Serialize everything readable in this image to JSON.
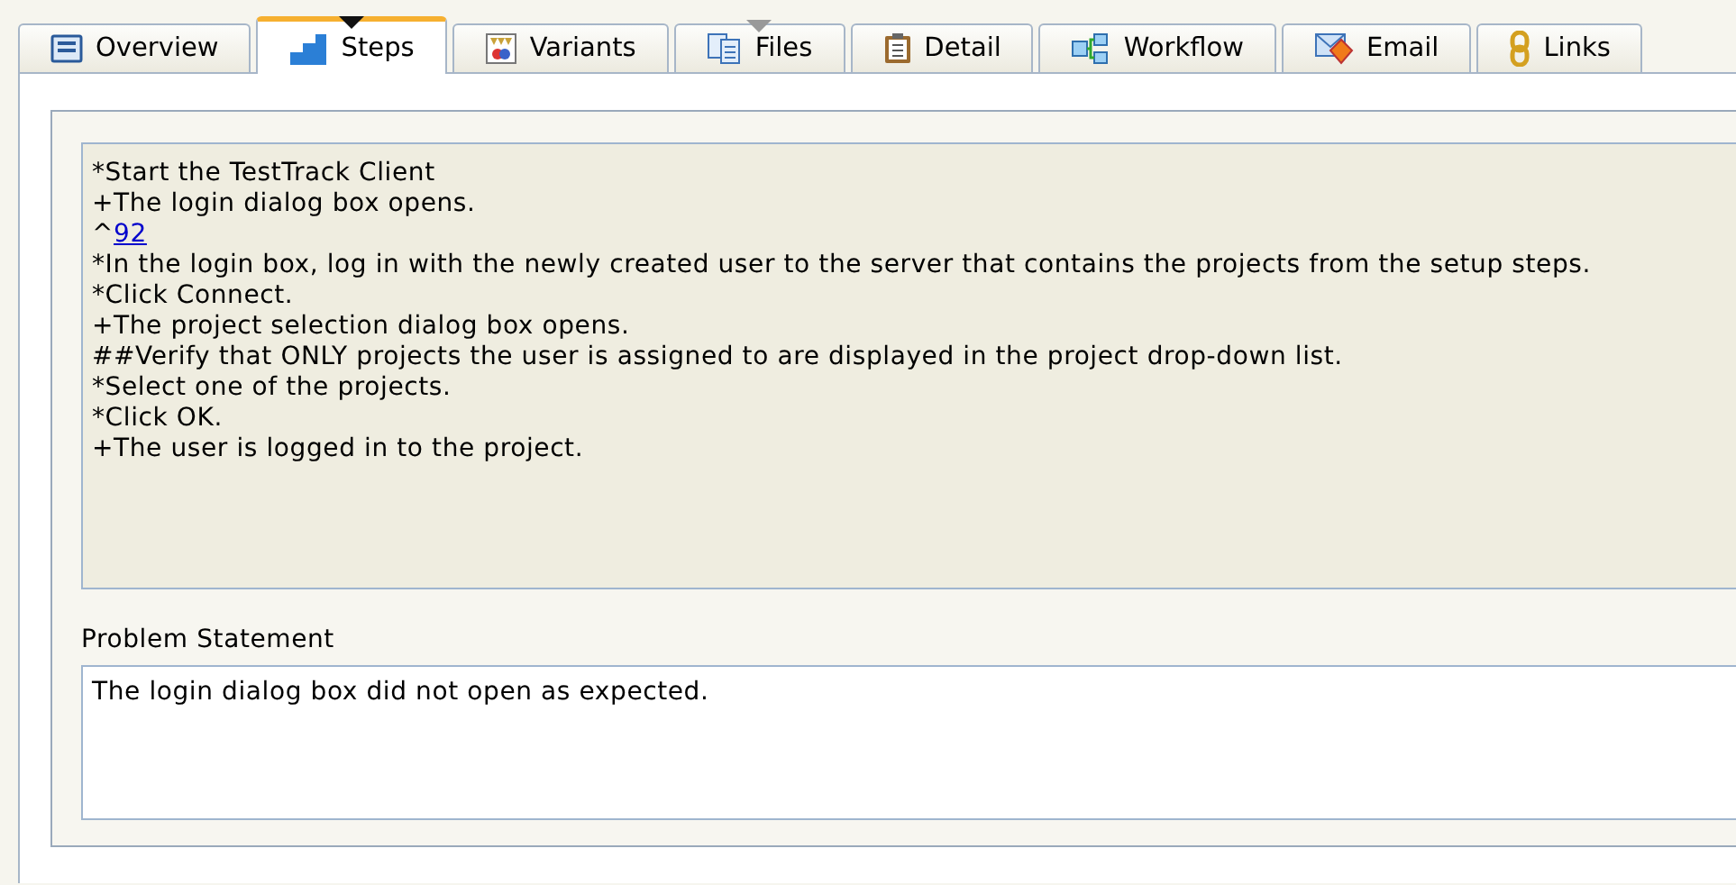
{
  "tabs": [
    {
      "label": "Overview",
      "selected": false,
      "has_menu": false
    },
    {
      "label": "Steps",
      "selected": true,
      "has_menu": true
    },
    {
      "label": "Variants",
      "selected": false,
      "has_menu": false
    },
    {
      "label": "Files",
      "selected": false,
      "has_menu": true
    },
    {
      "label": "Detail",
      "selected": false,
      "has_menu": false
    },
    {
      "label": "Workflow",
      "selected": false,
      "has_menu": false
    },
    {
      "label": "Email",
      "selected": false,
      "has_menu": false
    },
    {
      "label": "Links",
      "selected": false,
      "has_menu": false
    }
  ],
  "steps": [
    {
      "kind": "text",
      "text": "*Start the TestTrack Client"
    },
    {
      "kind": "text",
      "text": "+The login dialog box opens."
    },
    {
      "kind": "link",
      "text": "^",
      "link": "92"
    },
    {
      "kind": "text",
      "text": "*In the login box, log in with the newly created user to the server that contains the projects from the setup steps."
    },
    {
      "kind": "text",
      "text": "*Click Connect."
    },
    {
      "kind": "text",
      "text": "+The project selection dialog box opens."
    },
    {
      "kind": "text",
      "text": "##Verify that ONLY projects the user is assigned to are displayed in the project drop-down list."
    },
    {
      "kind": "text",
      "text": "*Select one of the projects."
    },
    {
      "kind": "text",
      "text": "*Click OK."
    },
    {
      "kind": "text",
      "text": "+The user is logged in to the project."
    }
  ],
  "problem_statement": {
    "label": "Problem Statement",
    "value": "The login dialog box did not open as expected."
  }
}
